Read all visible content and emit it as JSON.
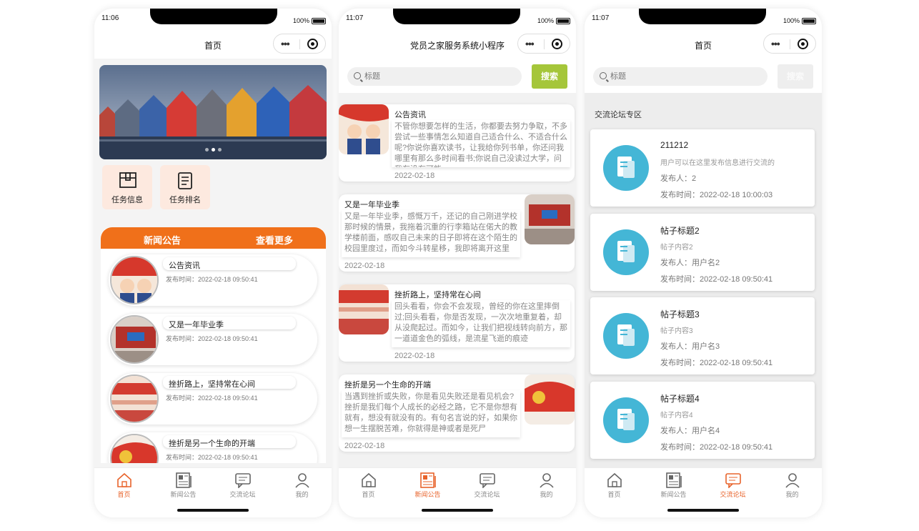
{
  "phones": [
    {
      "status": {
        "time": "11:06",
        "battery": "100%"
      },
      "title": "首页",
      "quick": [
        "任务信息",
        "任务排名"
      ],
      "news_header": {
        "title": "新闻公告",
        "more": "查看更多"
      },
      "news": [
        {
          "title": "公告资讯",
          "time": "发布时间：2022-02-18 09:50:41"
        },
        {
          "title": "又是一年毕业季",
          "time": "发布时间：2022-02-18 09:50:41"
        },
        {
          "title": "挫折路上，坚持常在心间",
          "time": "发布时间：2022-02-18 09:50:41"
        },
        {
          "title": "挫折是另一个生命的开端",
          "time": "发布时间：2022-02-18 09:50:41"
        }
      ],
      "tabs": [
        "首页",
        "新闻公告",
        "交流论坛",
        "我的"
      ]
    },
    {
      "status": {
        "time": "11:07",
        "battery": "100%"
      },
      "title": "党员之家服务系统小程序",
      "search": {
        "placeholder": "标题",
        "button": "搜索"
      },
      "articles": [
        {
          "title": "公告资讯",
          "body": "不管你想要怎样的生活，你都要去努力争取，不多尝试一些事情怎么知道自己适合什么、不适合什么呢?你说你喜欢读书，让我给你列书单，你还问我哪里有那么多时间看书;你说自己没读过大学，问我有没有可能",
          "date": "2022-02-18"
        },
        {
          "title": "又是一年毕业季",
          "body": "又是一年毕业季，感慨万千，还记的自己刚进学校那时候的情景，我拖着沉重的行李箱站在偌大的教学楼前面，感叹自己未来的日子即将在这个陌生的校园里度过，而如今斗转星移，我即将离开这里",
          "date": "2022-02-18"
        },
        {
          "title": "挫折路上，坚持常在心间",
          "body": "回头看看，你会不会发现，曾经的你在这里摔倒过;回头看看，你是否发现，一次次地重复着，却从没爬起过。而如今，让我们把视线转向前方，那一道道金色的弧线，是流星飞逝的痕迹",
          "date": "2022-02-18"
        },
        {
          "title": "挫折是另一个生命的开端",
          "body": "当遇到挫折或失败，你是看见失败还是看见机会?挫折是我们每个人成长的必经之路，它不是你想有就有，想没有就没有的。有句名言说的好，如果你想一生摆脱苦难，你就得是神或者是死尸",
          "date": "2022-02-18"
        }
      ],
      "tabs": [
        "首页",
        "新闻公告",
        "交流论坛",
        "我的"
      ]
    },
    {
      "status": {
        "time": "11:07",
        "battery": "100%"
      },
      "title": "首页",
      "search": {
        "placeholder": "标题",
        "button": "搜索"
      },
      "section_title": "交流论坛专区",
      "posts": [
        {
          "title": "211212",
          "content": "用户可以在这里发布信息进行交流的",
          "author": "发布人：2",
          "time": "发布时间：2022-02-18 10:00:03"
        },
        {
          "title": "帖子标题2",
          "content": "帖子内容2",
          "author": "发布人：用户名2",
          "time": "发布时间：2022-02-18 09:50:41"
        },
        {
          "title": "帖子标题3",
          "content": "帖子内容3",
          "author": "发布人：用户名3",
          "time": "发布时间：2022-02-18 09:50:41"
        },
        {
          "title": "帖子标题4",
          "content": "帖子内容4",
          "author": "发布人：用户名4",
          "time": "发布时间：2022-02-18 09:50:41"
        }
      ],
      "tabs": [
        "首页",
        "新闻公告",
        "交流论坛",
        "我的"
      ]
    }
  ],
  "colors": {
    "accent": "#e8632b",
    "news_header": "#f0701a",
    "search_active": "#a5c63a",
    "search_disabled": "#eeeeee",
    "forum_icon": "#44b6d6"
  },
  "icons": {
    "tabs": [
      "home-icon",
      "news-icon",
      "forum-icon",
      "user-icon"
    ],
    "quick": [
      "box-icon",
      "list-icon"
    ]
  }
}
